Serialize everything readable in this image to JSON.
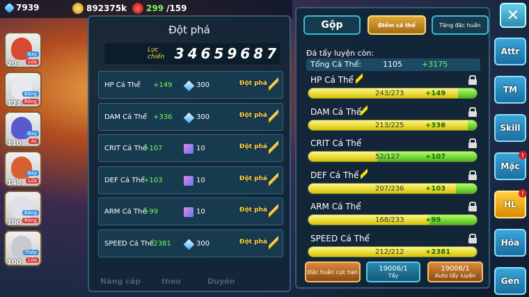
{
  "resources": {
    "gems": "7939",
    "gold": "892375k",
    "stamina": "299",
    "stamina_max": "/159"
  },
  "pets": [
    {
      "level": "20",
      "tag1": "Bay",
      "tag2": "Lửa",
      "color": "#d84a30"
    },
    {
      "level": "121",
      "tag1": "Băng",
      "tag2": "Rồng",
      "color": "#e8e8f0"
    },
    {
      "level": "110",
      "tag1": "Bay",
      "tag2": "Ác",
      "color": "#5a5ad0"
    },
    {
      "level": "148",
      "tag1": "Bay",
      "tag2": "Lửa",
      "color": "#d86030"
    },
    {
      "level": "100",
      "tag1": "Băng",
      "tag2": "Rồng",
      "color": "#e0e0e8"
    },
    {
      "level": "100",
      "tag1": "Thép",
      "tag2": "Lửa",
      "color": "#c8c8d0"
    }
  ],
  "left_panel": {
    "title": "Đột phá",
    "power_label": "Lực chiến",
    "power_value": "34659687",
    "rows": [
      {
        "name": "HP Cá Thể",
        "add": "+149",
        "cost": "300",
        "currency": "gem",
        "button": "Đột phá"
      },
      {
        "name": "DAM Cá Thể",
        "add": "+336",
        "cost": "300",
        "currency": "gem",
        "button": "Đột phá"
      },
      {
        "name": "CRIT Cá Thể",
        "add": "+107",
        "cost": "10",
        "currency": "scroll",
        "button": "Đột phá"
      },
      {
        "name": "DEF Cá Thể",
        "add": "+103",
        "cost": "10",
        "currency": "scroll",
        "button": "Đột phá"
      },
      {
        "name": "ARM Cá Thể",
        "add": "+99",
        "cost": "10",
        "currency": "scroll",
        "button": "Đột phá"
      },
      {
        "name": "SPEED Cá Thể",
        "add": "+2381",
        "cost": "300",
        "currency": "gem",
        "button": "Đột phá"
      }
    ]
  },
  "right_panel": {
    "tab_merge": "Gộp",
    "tab_points": "Điểm cá thể",
    "tab_bonus": "Tăng đặc huấn",
    "subtitle": "Đá tẩy luyện còn:",
    "total_label": "Tổng Cá Thể:",
    "total_value": "1105",
    "total_add": "+3175",
    "stats": [
      {
        "name": "HP Cá Thể",
        "current": 243,
        "max": 273,
        "text": "243/273",
        "add": "+149",
        "bolt": true
      },
      {
        "name": "DAM Cá Thể",
        "current": 213,
        "max": 225,
        "text": "213/225",
        "add": "+336",
        "bolt": true
      },
      {
        "name": "CRIT Cá Thể",
        "current": 52,
        "max": 127,
        "text": "52/127",
        "add": "+107",
        "bolt": false
      },
      {
        "name": "DEF Cá Thể",
        "current": 207,
        "max": 236,
        "text": "207/236",
        "add": "+103",
        "bolt": true
      },
      {
        "name": "ARM Cá Thể",
        "current": 168,
        "max": 233,
        "text": "168/233",
        "add": "+99",
        "bolt": false
      },
      {
        "name": "SPEED Cá Thể",
        "current": 212,
        "max": 212,
        "text": "212/212",
        "add": "+2381",
        "bolt": false
      }
    ],
    "btn_special": "Đặc huấn cực hạn",
    "btn_wash_count": "19006/1",
    "btn_wash": "Tẩy",
    "btn_auto_count": "19006/1",
    "btn_auto": "Auto tẩy luyện"
  },
  "side_menu": [
    "Attr",
    "TM",
    "Skill",
    "Mặc",
    "HL",
    "Hóa",
    "Gen"
  ],
  "side_alerts": [
    "Mặc",
    "HL"
  ],
  "bottom_labels": [
    "Nâng cấp",
    "theo",
    "Duyên"
  ]
}
